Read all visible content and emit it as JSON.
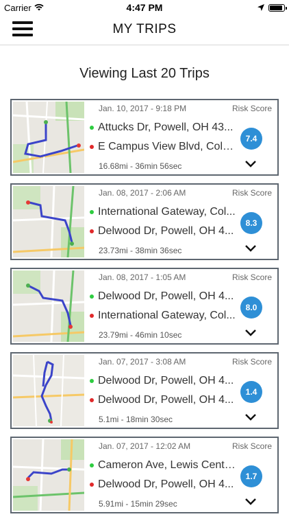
{
  "status_bar": {
    "carrier": "Carrier",
    "time": "4:47 PM",
    "icons": [
      "wifi-icon",
      "location-arrow-icon",
      "battery-icon"
    ]
  },
  "nav": {
    "title": "MY TRIPS",
    "menu_icon": "hamburger-menu-icon"
  },
  "section_title": "Viewing Last 20 Trips",
  "colors": {
    "accent": "#2e8fd6",
    "card_border": "#5d6670",
    "start_dot": "#2ecc40",
    "end_dot": "#e0292a"
  },
  "trips": [
    {
      "date": "Jan. 10, 2017 - 9:18 PM",
      "risk_label": "Risk Score",
      "start": "Attucks Dr, Powell, OH 43...",
      "end": "E Campus View Blvd, Colu...",
      "stats": "16.68mi - 36min 56sec",
      "score": "7.4"
    },
    {
      "date": "Jan. 08, 2017 - 2:06 AM",
      "risk_label": "Risk Score",
      "start": "International Gateway, Col...",
      "end": "Delwood Dr, Powell, OH 4...",
      "stats": "23.73mi - 38min 36sec",
      "score": "8.3"
    },
    {
      "date": "Jan. 08, 2017 - 1:05 AM",
      "risk_label": "Risk Score",
      "start": "Delwood Dr, Powell, OH 4...",
      "end": "International Gateway, Col...",
      "stats": "23.79mi - 46min 10sec",
      "score": "8.0"
    },
    {
      "date": "Jan. 07, 2017 - 3:08 AM",
      "risk_label": "Risk Score",
      "start": "Delwood Dr, Powell, OH 4...",
      "end": "Delwood Dr, Powell, OH 4...",
      "stats": "5.1mi - 18min 30sec",
      "score": "1.4"
    },
    {
      "date": "Jan. 07, 2017 - 12:02 AM",
      "risk_label": "Risk Score",
      "start": "Cameron Ave, Lewis Cente...",
      "end": "Delwood Dr, Powell, OH 4...",
      "stats": "5.91mi - 15min 29sec",
      "score": "1.7"
    }
  ]
}
